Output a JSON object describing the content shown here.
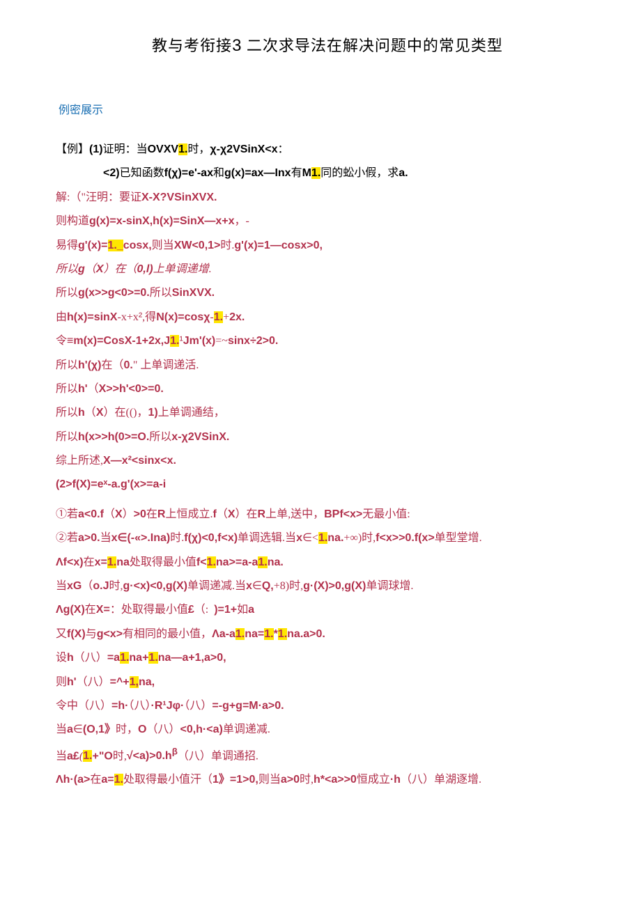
{
  "title": {
    "left": "教与考衔接",
    "num": "3",
    "gap": "    ",
    "right": "二次求导法在解决问题中的常见类型"
  },
  "section_label": "例密展示",
  "lines": [
    {
      "cls": "q-black",
      "html": "【例】<span class='bold-latin'>(1)</span>证明：当<span class='bold-latin'>OVXV</span><span class='hl bold-latin'>1.</span>时，<span class='bold-latin'>χ-χ2VSinX&lt;x</span>："
    },
    {
      "cls": "q-black indent1",
      "html": "<span class='bold-latin'>&lt;2)</span>已知函数<span class='bold-latin'>f(χ)=e'-ax</span>和<span class='bold-latin'>g(x)=ax—Inx</span>有<span class='bold-latin'>M</span><span class='hl bold-latin'>1.</span>同的蚣小假，求<span class='bold-latin'>a.</span>"
    },
    {
      "cls": "ans-red",
      "html": "解:（\"汪明：要证<span class='bold-latin'>X-X?VSinXVX.</span>"
    },
    {
      "cls": "ans-red",
      "html": "则构道<span class='bold-latin'>g(x)=x-sinX,h(x)=SinX—x+x</span>，-"
    },
    {
      "cls": "ans-red",
      "html": "易得<span class='bold-latin'>g'(x)=</span><span class='hl bold-latin'>1._</span><span class='bold-latin'>cosx,</span>则当<span class='bold-latin'>XW&lt;0,1&gt;</span>时.<span class='bold-latin'>g'(x)=1—cosx&gt;0,</span>"
    },
    {
      "cls": "ans-red italic-cn",
      "html": "所以<span class='bold-latin'>g</span>（<span class='bold-latin'>X</span>）在（<span class='bold-latin'>0,l)</span>上单调递增."
    },
    {
      "cls": "ans-red",
      "html": "所以<span class='bold-latin'>g(x&gt;&gt;g&lt;0&gt;=0.</span>所以<span class='bold-latin'>SinXVX.</span>"
    },
    {
      "cls": "ans-red",
      "html": "由<span class='bold-latin'>h(x)=sinX</span>-x+x<span class='latin'>²</span>,得<span class='bold-latin'>N(x)=cosχ</span>-<span class='hl bold-latin'>1.</span>+<span class='bold-latin'>2x.</span>"
    },
    {
      "cls": "ans-red",
      "html": "令<span class='bold-latin'>≡m(x)=CosX-1+2x,J</span><span class='hl bold-latin'>1.</span><span class='latin'>¹</span><span class='bold-latin'>Jm'(x)</span>=~<span class='bold-latin'>sinx÷2&gt;0.</span>"
    },
    {
      "cls": "ans-red",
      "html": "所以<span class='bold-latin'>h'(χ)</span>在（<span class='bold-latin'>0.</span>\" 上单调递活."
    },
    {
      "cls": "ans-red",
      "html": "所以<span class='bold-latin'>h'</span>（<span class='bold-latin'>X&gt;&gt;h'&lt;0&gt;=0.</span>"
    },
    {
      "cls": "ans-red",
      "html": "所以<span class='bold-latin'>h</span>（<span class='bold-latin'>X</span>）在(()，<span class='bold-latin'>1)</span>上单调通结，"
    },
    {
      "cls": "ans-red",
      "html": "所以<span class='bold-latin'>h(x&gt;&gt;h(0&gt;=O.</span>所以<span class='bold-latin'>x-χ2VSinX.</span>"
    },
    {
      "cls": "ans-red",
      "html": "综上所述,<span class='bold-latin'>X—x²&lt;sinx&lt;x.</span>"
    },
    {
      "cls": "ans-red",
      "html": "<span class='bold-latin'>(2&gt;f(X)=eˣ-a.g'(x&gt;=a-i</span>"
    },
    {
      "cls": "spacer",
      "html": ""
    },
    {
      "cls": "ans-red",
      "html": "①若<span class='bold-latin'>a&lt;0.f</span>（<span class='bold-latin'>X</span>）<span class='bold-latin'>&gt;0</span>在<span class='bold-latin'>R</span>上恒成立.<span class='bold-latin'>f</span>（<span class='bold-latin'>X</span>）在<span class='bold-latin'>R</span>上单,送中，<span class='bold-latin'>BPf&lt;x&gt;</span>无最小值:"
    },
    {
      "cls": "ans-red",
      "html": "②若<span class='bold-latin'>a&gt;0.</span>当<span class='bold-latin'>x∈(-«&gt;.Ina)</span>时.<span class='bold-latin'>f(χ)&lt;0,f&lt;x)</span>单调选辑.当<span class='bold-latin'>x</span>∈&lt;<span class='hl bold-latin'>1.</span><span class='bold-latin'>na.</span>+∞)时,<span class='bold-latin'>f&lt;x&gt;&gt;0.f(x&gt;</span>单型堂增."
    },
    {
      "cls": "ans-red",
      "html": "<span class='bold-latin'>Λf&lt;x)</span>在<span class='bold-latin'>x=</span><span class='hl bold-latin'>1.</span><span class='bold-latin'>na</span>处取得最小值<span class='bold-latin'>f&lt;</span><span class='hl bold-latin'>1.</span><span class='bold-latin'>na&gt;=a-a</span><span class='hl bold-latin'>1.</span><span class='bold-latin'>na.</span>"
    },
    {
      "cls": "ans-red",
      "html": "当<span class='bold-latin'>xG</span>（<span class='bold-latin'>o.J</span>时,<span class='bold-latin'>g·&lt;x)&lt;0,g(X)</span>单调递减.当<span class='bold-latin'>x</span>∈<span class='bold-latin'>Q,</span>+8)时,<span class='bold-latin'>g·(X)&gt;0,g(X)</span>单调球增."
    },
    {
      "cls": "ans-red",
      "html": "<span class='bold-latin'>Λg(X)</span>在<span class='bold-latin'>X=</span>：处取得最小值<span class='bold-latin'>£</span>（:  <span class='bold-latin'>)=1+</span>如<span class='bold-latin'>a</span>"
    },
    {
      "cls": "ans-red",
      "html": "又<span class='bold-latin'>f(X)</span>与<span class='bold-latin'>g&lt;x&gt;</span>有相同的最小值，<span class='bold-latin'>Λa-a</span><span class='hl bold-latin'>1.</span><span class='bold-latin'>na=</span><span class='hl bold-latin'>1.</span><span class='bold-latin'>*</span><span class='hl bold-latin'>1.</span><span class='bold-latin'>na.a&gt;0.</span>"
    },
    {
      "cls": "ans-red",
      "html": "设<span class='bold-latin'>h</span>（八）<span class='bold-latin'>=a</span><span class='hl bold-latin'>1.</span><span class='bold-latin'>na+</span><span class='hl bold-latin'>1.</span><span class='bold-latin'>na—a+1,a&gt;0,</span>"
    },
    {
      "cls": "ans-red",
      "html": "则<span class='bold-latin'>h'</span>（八）<span class='bold-latin'>=^+</span><span class='hl bold-latin'>1,</span><span class='bold-latin'>na,</span>"
    },
    {
      "cls": "ans-red",
      "html": "令中（八）<span class='bold-latin'>=h·</span>（八）<span class='bold-latin'>·R¹Jφ·</span>（八）<span class='bold-latin'>=-g+g=M·a&gt;0.</span>"
    },
    {
      "cls": "ans-red",
      "html": "当<span class='bold-latin'>a</span>∈<span class='bold-latin'>(O,1》</span>时，<span class='bold-latin'>O</span>（八）<span class='bold-latin'>&lt;0,h·&lt;a)</span>单调递减."
    },
    {
      "cls": "ans-red",
      "html": "当<span class='bold-latin'>a£</span><span class='italic-cn'>(</span><span class='hl bold-latin'>1.</span><span class='bold-latin'>+\"O</span>时,<span class='bold-latin'>√&lt;a)&gt;0.h<sup>β</sup></span>（八）单调通招."
    },
    {
      "cls": "ans-red",
      "html": "<span class='bold-latin'>Λh·(a&gt;</span>在<span class='bold-latin'>a=</span><span class='hl bold-latin'>1.</span>处取得最小值汗（<span class='bold-latin'>1》=1&gt;0,</span>则当<span class='bold-latin'>a&gt;0</span>时,<span class='bold-latin'>h*&lt;a&gt;&gt;0</span>恒成立<span class='bold-latin'>·h</span>（八）单湖逐增."
    }
  ]
}
